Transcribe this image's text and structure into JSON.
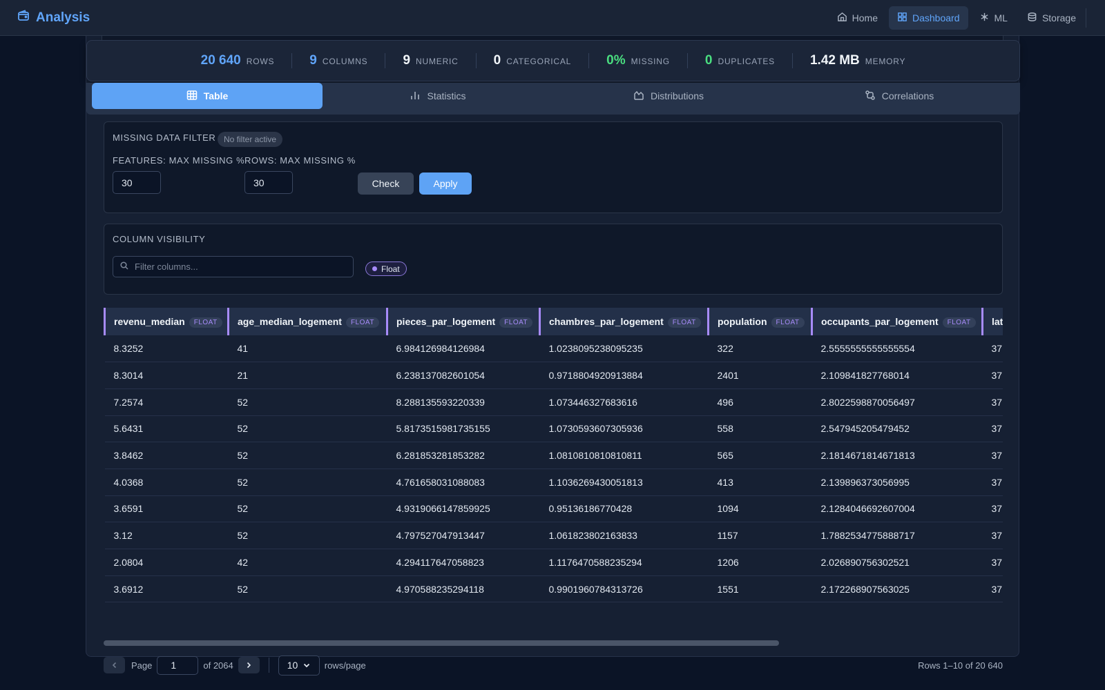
{
  "app": {
    "title": "Analysis"
  },
  "nav": {
    "items": [
      {
        "label": "Home",
        "icon": "home-icon",
        "active": false
      },
      {
        "label": "Dashboard",
        "icon": "grid-icon",
        "active": true
      },
      {
        "label": "ML",
        "icon": "ml-icon",
        "active": false
      },
      {
        "label": "Storage",
        "icon": "database-icon",
        "active": false
      }
    ]
  },
  "stats": [
    {
      "value": "20 640",
      "label": "ROWS",
      "color": "#60a5fa"
    },
    {
      "value": "9",
      "label": "COLUMNS",
      "color": "#60a5fa"
    },
    {
      "value": "9",
      "label": "NUMERIC",
      "color": "#f1f5f9"
    },
    {
      "value": "0",
      "label": "CATEGORICAL",
      "color": "#f1f5f9"
    },
    {
      "value": "0%",
      "label": "MISSING",
      "color": "#4ade80"
    },
    {
      "value": "0",
      "label": "DUPLICATES",
      "color": "#4ade80"
    },
    {
      "value": "1.42 MB",
      "label": "MEMORY",
      "color": "#f1f5f9"
    }
  ],
  "tabs": [
    {
      "label": "Table",
      "active": true
    },
    {
      "label": "Statistics",
      "active": false
    },
    {
      "label": "Distributions",
      "active": false
    },
    {
      "label": "Correlations",
      "active": false
    }
  ],
  "missing_filter": {
    "title": "MISSING DATA FILTER",
    "status": "No filter active",
    "features_label": "FEATURES: MAX MISSING %",
    "features_value": "30",
    "rows_label": "ROWS: MAX MISSING %",
    "rows_value": "30",
    "check_label": "Check",
    "apply_label": "Apply"
  },
  "column_visibility": {
    "title": "COLUMN VISIBILITY",
    "search_placeholder": "Filter columns...",
    "type_filter": "Float"
  },
  "table": {
    "columns": [
      {
        "name": "revenu_median",
        "type": "FLOAT"
      },
      {
        "name": "age_median_logement",
        "type": "FLOAT"
      },
      {
        "name": "pieces_par_logement",
        "type": "FLOAT"
      },
      {
        "name": "chambres_par_logement",
        "type": "FLOAT"
      },
      {
        "name": "population",
        "type": "FLOAT"
      },
      {
        "name": "occupants_par_logement",
        "type": "FLOAT"
      },
      {
        "name": "lat",
        "type": ""
      }
    ],
    "rows": [
      [
        "8.3252",
        "41",
        "6.984126984126984",
        "1.0238095238095235",
        "322",
        "2.5555555555555554",
        "37."
      ],
      [
        "8.3014",
        "21",
        "6.238137082601054",
        "0.9718804920913884",
        "2401",
        "2.109841827768014",
        "37."
      ],
      [
        "7.2574",
        "52",
        "8.288135593220339",
        "1.073446327683616",
        "496",
        "2.8022598870056497",
        "37."
      ],
      [
        "5.6431",
        "52",
        "5.8173515981735155",
        "1.0730593607305936",
        "558",
        "2.547945205479452",
        "37."
      ],
      [
        "3.8462",
        "52",
        "6.281853281853282",
        "1.0810810810810811",
        "565",
        "2.1814671814671813",
        "37."
      ],
      [
        "4.0368",
        "52",
        "4.761658031088083",
        "1.1036269430051813",
        "413",
        "2.139896373056995",
        "37."
      ],
      [
        "3.6591",
        "52",
        "4.9319066147859925",
        "0.95136186770428",
        "1094",
        "2.1284046692607004",
        "37."
      ],
      [
        "3.12",
        "52",
        "4.797527047913447",
        "1.061823802163833",
        "1157",
        "1.7882534775888717",
        "37."
      ],
      [
        "2.0804",
        "42",
        "4.294117647058823",
        "1.1176470588235294",
        "1206",
        "2.026890756302521",
        "37."
      ],
      [
        "3.6912",
        "52",
        "4.970588235294118",
        "0.9901960784313726",
        "1551",
        "2.172268907563025",
        "37."
      ]
    ]
  },
  "pagination": {
    "page_label": "Page",
    "page_value": "1",
    "of_label": "of 2064",
    "rows_per_page": "10",
    "rows_per_page_label": "rows/page",
    "summary": "Rows 1–10 of 20 640"
  }
}
